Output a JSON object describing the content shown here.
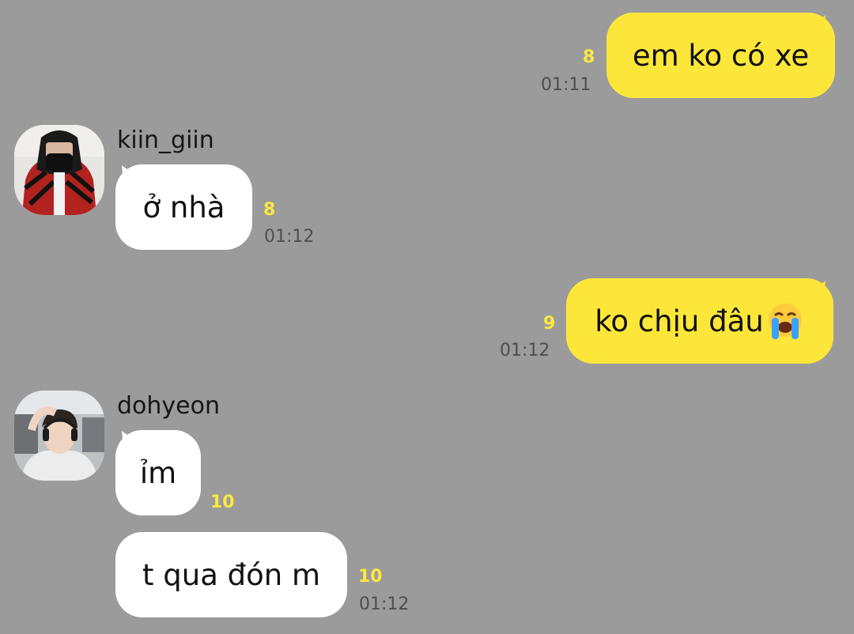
{
  "messages": [
    {
      "from": "me",
      "text": "em ko có xe",
      "unread": "8",
      "time": "01:11"
    },
    {
      "from": "kiin_giin",
      "text": "ở nhà",
      "unread": "8",
      "time": "01:12"
    },
    {
      "from": "me",
      "text": "ko chịu đâu",
      "emoji": "loudly-crying-face-icon",
      "unread": "9",
      "time": "01:12"
    },
    {
      "from": "dohyeon",
      "text": "ỉm",
      "unread": "10"
    },
    {
      "from": "dohyeon",
      "text": "t qua đón m",
      "unread": "10",
      "time": "01:12"
    }
  ],
  "senders": {
    "kiin_giin": "kiin_giin",
    "dohyeon": "dohyeon"
  },
  "colors": {
    "background": "#9b9b9b",
    "my_bubble": "#fce63a",
    "their_bubble": "#ffffff",
    "unread": "#fbe83f",
    "timestamp": "#4f4f4f"
  }
}
